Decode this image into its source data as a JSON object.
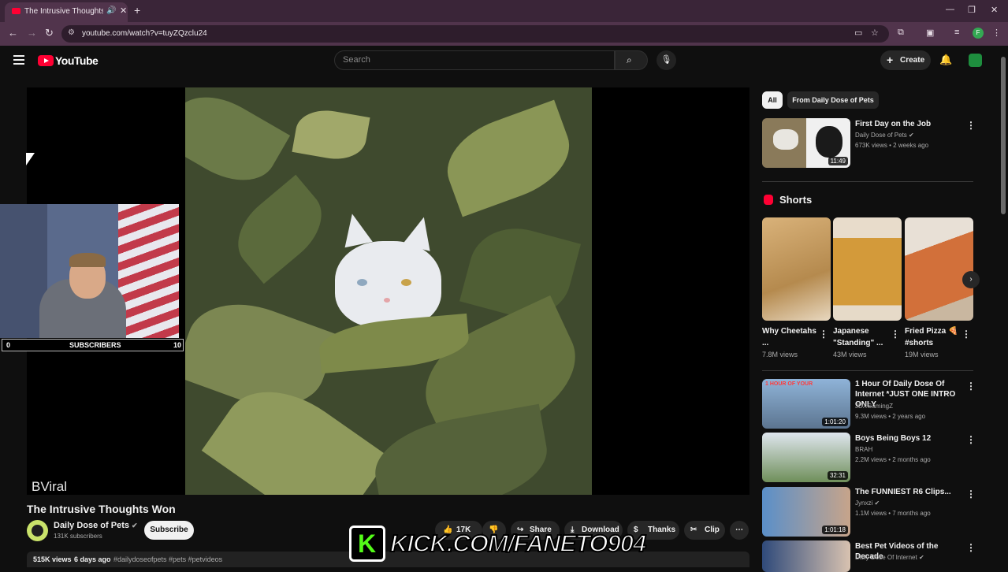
{
  "browser": {
    "tab_title": "The Intrusive Thoughts Wo",
    "url": "youtube.com/watch?v=tuyZQzclu24",
    "profile_initial": "F"
  },
  "header": {
    "logo_text": "YouTube",
    "search_placeholder": "Search",
    "create_label": "Create"
  },
  "player": {
    "watermark": "BViral"
  },
  "overlay": {
    "subs_left": "0",
    "subs_label": "SUBSCRIBERS",
    "subs_right": "10",
    "kick_text": "KICK.COM/FANETO904"
  },
  "video": {
    "title": "The Intrusive Thoughts Won",
    "channel_name": "Daily Dose of Pets",
    "subscribers": "131K subscribers",
    "subscribe_label": "Subscribe",
    "likes": "17K",
    "share_label": "Share",
    "download_label": "Download",
    "thanks_label": "Thanks",
    "clip_label": "Clip",
    "views": "515K views",
    "age": "6 days ago",
    "hashtags": "#dailydoseofpets #pets #petvideos"
  },
  "sidebar": {
    "chips": [
      "All",
      "From Daily Dose of Pets"
    ],
    "first": {
      "title": "First Day on the Job",
      "channel": "Daily Dose of Pets",
      "meta": "673K views • 2 weeks ago",
      "duration": "11:49"
    },
    "shorts_label": "Shorts",
    "shorts": [
      {
        "title": "Why Cheetahs ...",
        "views": "7.8M views"
      },
      {
        "title": "Japanese \"Standing\" ...",
        "views": "43M views"
      },
      {
        "title": "Fried Pizza 🍕 #shorts",
        "views": "19M views"
      }
    ],
    "videos": [
      {
        "title": "1 Hour Of Daily Dose Of Internet *JUST ONE INTRO ONLY",
        "channel": "JDXGamingZ",
        "meta": "9.3M views • 2 years ago",
        "duration": "1:01:20",
        "thumb_text": "1 HOUR OF YOUR"
      },
      {
        "title": "Boys Being Boys 12",
        "channel": "BRAH",
        "meta": "2.2M views • 2 months ago",
        "duration": "32:31"
      },
      {
        "title": "The FUNNIEST R6 Clips...",
        "channel": "Jynxzi",
        "meta": "1.1M views • 7 months ago",
        "duration": "1:01:18"
      },
      {
        "title": "Best Pet Videos of the Decade",
        "channel": "Daily Dose Of Internet",
        "meta": "",
        "duration": ""
      }
    ]
  },
  "colors": {
    "yt_red": "#ff0033",
    "browser_frame": "#51344c",
    "kick_green": "#53fc18"
  }
}
